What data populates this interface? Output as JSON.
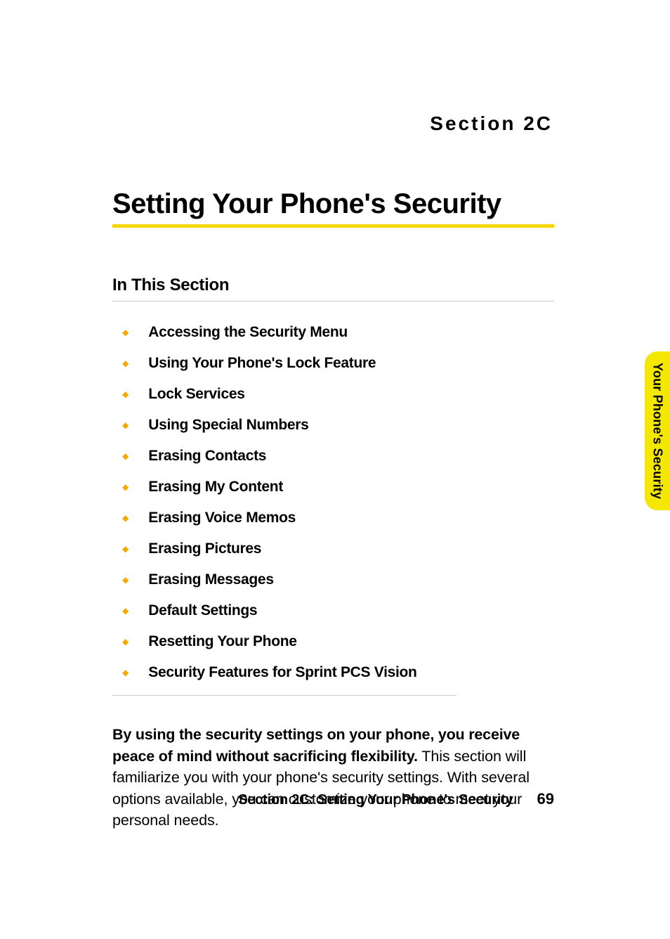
{
  "header": {
    "section_label": "Section 2C"
  },
  "title": "Setting Your Phone's Security",
  "subsection": {
    "heading": "In This Section",
    "items": [
      "Accessing the Security Menu",
      "Using Your Phone's Lock Feature",
      "Lock Services",
      "Using Special Numbers",
      "Erasing Contacts",
      "Erasing My Content",
      "Erasing Voice Memos",
      "Erasing Pictures",
      "Erasing Messages",
      "Default Settings",
      "Resetting Your Phone",
      "Security Features for Sprint PCS Vision"
    ]
  },
  "body": {
    "lead_bold": "By using the security settings on your phone, you receive peace of mind without sacrificing flexibility.",
    "rest": " This section will familiarize you with your phone's security settings. With several options available, you can customize your phone to meet your personal needs."
  },
  "side_tab": "Your Phone's Security",
  "footer": {
    "title": "Section 2C: Setting Your Phone's Security",
    "page": "69"
  }
}
